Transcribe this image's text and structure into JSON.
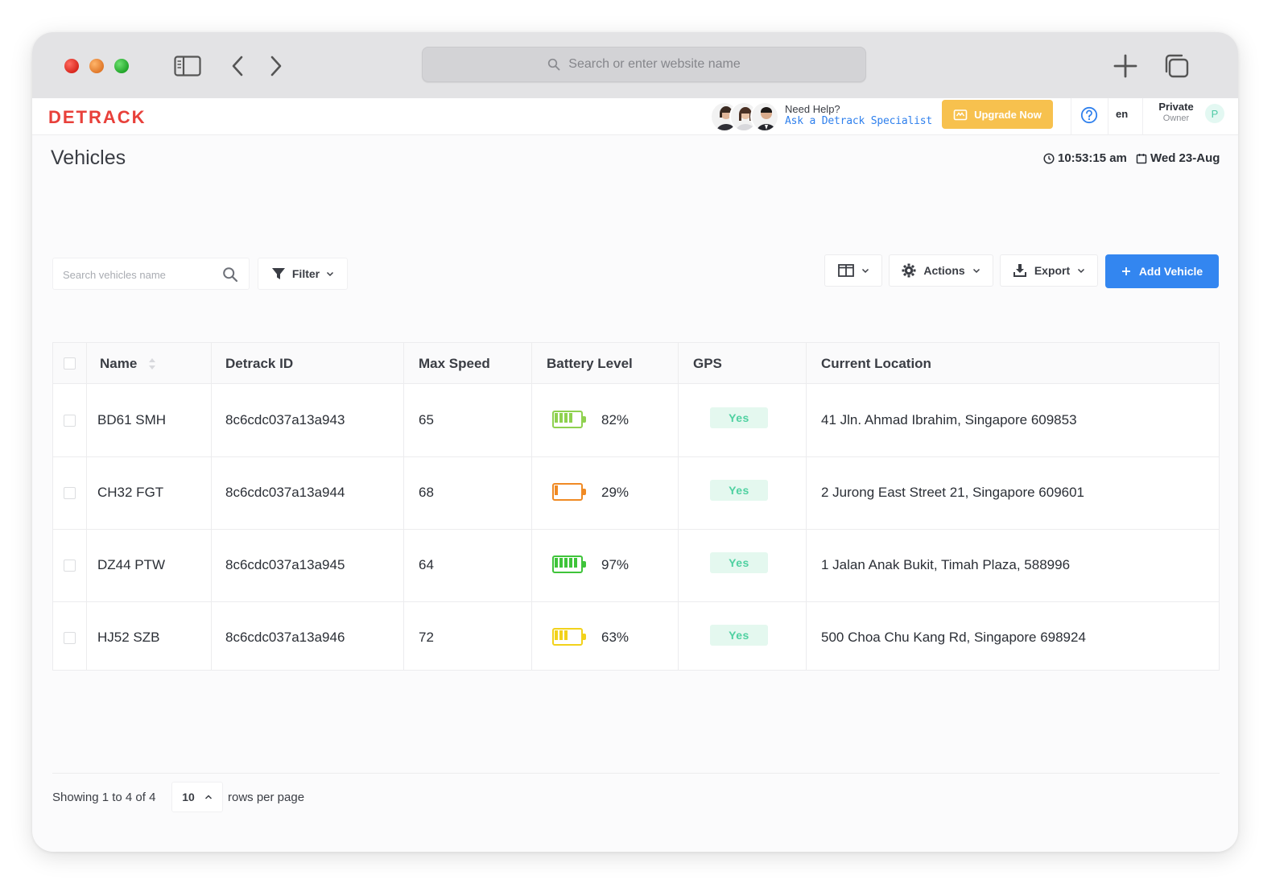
{
  "browser": {
    "address_placeholder": "Search or enter website name"
  },
  "header": {
    "logo_text": "DETRACK",
    "help_question": "Need Help?",
    "help_link": "Ask a Detrack Specialist",
    "upgrade_label": "Upgrade Now",
    "language": "en",
    "user_name": "Private",
    "user_role": "Owner",
    "user_initial": "P",
    "colors": {
      "brand_red": "#e8403a",
      "upgrade_yellow": "#f7c14e",
      "primary_blue": "#3386f0"
    }
  },
  "page": {
    "title": "Vehicles",
    "time": "10:53:15 am",
    "date": "Wed 23-Aug"
  },
  "toolbar": {
    "search_placeholder": "Search vehicles name",
    "filter_label": "Filter",
    "actions_label": "Actions",
    "export_label": "Export",
    "add_label": "Add Vehicle"
  },
  "table": {
    "columns": [
      "Name",
      "Detrack ID",
      "Max Speed",
      "Battery Level",
      "GPS",
      "Current Location"
    ],
    "rows": [
      {
        "name": "BD61 SMH",
        "detrack_id": "8c6cdc037a13a943",
        "max_speed": "65",
        "battery": "82%",
        "battery_level": 0.82,
        "battery_color": "#8fd14f",
        "gps": "Yes",
        "location": "41 Jln. Ahmad Ibrahim, Singapore 609853"
      },
      {
        "name": "CH32 FGT",
        "detrack_id": "8c6cdc037a13a944",
        "max_speed": "68",
        "battery": "29%",
        "battery_level": 0.29,
        "battery_color": "#f08a24",
        "gps": "Yes",
        "location": "2 Jurong East Street 21, Singapore 609601"
      },
      {
        "name": "DZ44 PTW",
        "detrack_id": "8c6cdc037a13a945",
        "max_speed": "64",
        "battery": "97%",
        "battery_level": 0.97,
        "battery_color": "#3fc43a",
        "gps": "Yes",
        "location": "1 Jalan Anak Bukit, Timah Plaza, 588996"
      },
      {
        "name": "HJ52 SZB",
        "detrack_id": "8c6cdc037a13a946",
        "max_speed": "72",
        "battery": "63%",
        "battery_level": 0.63,
        "battery_color": "#f2d21b",
        "gps": "Yes",
        "location": "500 Choa Chu Kang Rd, Singapore 698924"
      }
    ]
  },
  "footer": {
    "showing_text": "Showing 1 to 4 of 4",
    "rows_per_page_value": "10",
    "rows_per_page_label": "rows per page"
  }
}
